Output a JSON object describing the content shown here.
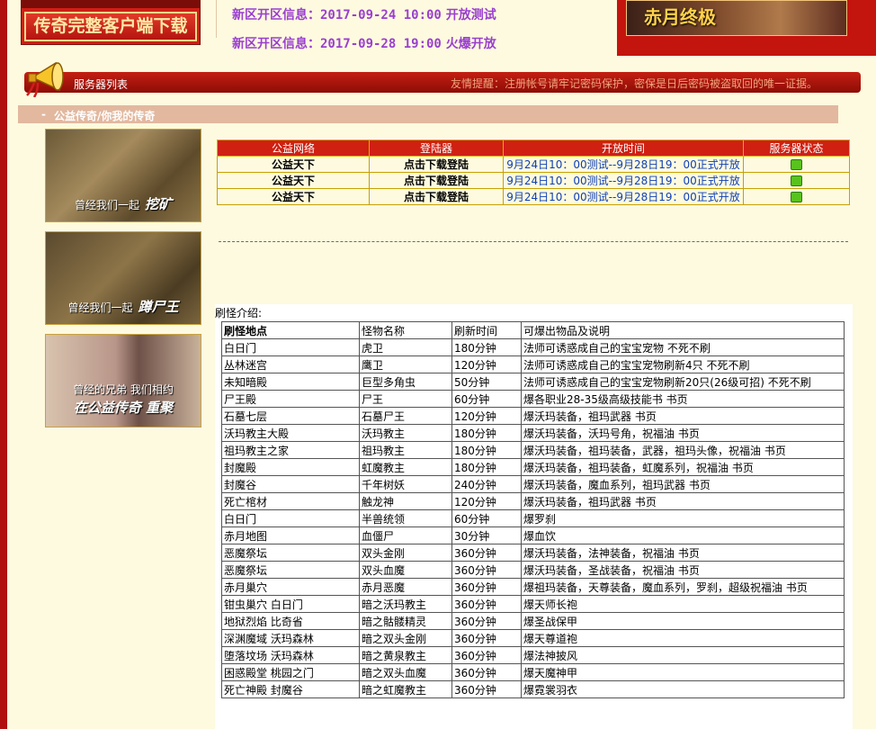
{
  "header": {
    "download_label": "传奇完整客户端下载",
    "news": [
      {
        "prefix": "新区开区信息：",
        "date": "2017-09-24 10:00",
        "status": "开放测试"
      },
      {
        "prefix": "新区开区信息：",
        "date": "2017-09-28 19:00",
        "status": "火爆开放"
      }
    ],
    "banner_right": "赤月终极"
  },
  "server_bar": {
    "title": "服务器列表",
    "tip": "友情提醒：注册帐号请牢记密码保护，密保是日后密码被盗取回的唯一证据。"
  },
  "section": {
    "dash": "-",
    "title": "公益传奇/你我的传奇"
  },
  "thumbs": [
    {
      "caption": "曾经我们一起",
      "emph": "挖矿"
    },
    {
      "caption": "曾经我们一起",
      "emph": "蹲尸王"
    },
    {
      "caption": "曾经的兄弟  我们相约",
      "emph": "在公益传奇  重聚"
    }
  ],
  "server_table": {
    "headers": [
      "公益网络",
      "登陆器",
      "开放时间",
      "服务器状态"
    ],
    "rows": [
      {
        "name": "公益天下",
        "login": "点击下载登陆",
        "time": "9月24日10：00测试--9月28日19：00正式开放"
      },
      {
        "name": "公益天下",
        "login": "点击下载登陆",
        "time": "9月24日10：00测试--9月28日19：00正式开放"
      },
      {
        "name": "公益天下",
        "login": "点击下载登陆",
        "time": "9月24日10：00测试--9月28日19：00正式开放"
      }
    ]
  },
  "monster": {
    "label": "刷怪介绍:",
    "headers": [
      "刷怪地点",
      "怪物名称",
      "刷新时间",
      "可爆出物品及说明"
    ],
    "rows": [
      [
        "白日门",
        "虎卫",
        "180分钟",
        "法师可诱惑成自己的宝宝宠物 不死不刷"
      ],
      [
        "丛林迷宫",
        "鹰卫",
        "120分钟",
        "法师可诱惑成自己的宝宝宠物刷新4只 不死不刷"
      ],
      [
        "未知暗殿",
        "巨型多角虫",
        "50分钟",
        "法师可诱惑成自己的宝宝宠物刷新20只(26级可招) 不死不刷"
      ],
      [
        "尸王殿",
        "尸王",
        "60分钟",
        "爆各职业28-35级高级技能书 书页"
      ],
      [
        "石墓七层",
        "石墓尸王",
        "120分钟",
        "爆沃玛装备，祖玛武器 书页"
      ],
      [
        "沃玛教主大殿",
        "沃玛教主",
        "180分钟",
        "爆沃玛装备，沃玛号角，祝福油 书页"
      ],
      [
        "祖玛教主之家",
        "祖玛教主",
        "180分钟",
        "爆沃玛装备，祖玛装备，武器，祖玛头像，祝福油 书页"
      ],
      [
        "封魔殿",
        "虹魔教主",
        "180分钟",
        "爆沃玛装备，祖玛装备，虹魔系列，祝福油 书页"
      ],
      [
        "封魔谷",
        "千年树妖",
        "240分钟",
        "爆沃玛装备，魔血系列，祖玛武器 书页"
      ],
      [
        "死亡棺材",
        "触龙神",
        "120分钟",
        "爆沃玛装备，祖玛武器 书页"
      ],
      [
        "白日门",
        "半兽统领",
        "60分钟",
        "爆罗刹"
      ],
      [
        "赤月地图",
        "血僵尸",
        "30分钟",
        "爆血饮"
      ],
      [
        "恶魔祭坛",
        "双头金刚",
        "360分钟",
        "爆沃玛装备，法神装备，祝福油 书页"
      ],
      [
        "恶魔祭坛",
        "双头血魔",
        "360分钟",
        "爆沃玛装备，圣战装备，祝福油 书页"
      ],
      [
        "赤月巢穴",
        "赤月恶魔",
        "360分钟",
        "爆祖玛装备，天尊装备，魔血系列，罗刹，超级祝福油 书页"
      ],
      [
        "钳虫巢穴 白日门",
        "暗之沃玛教主",
        "360分钟",
        "爆天师长袍"
      ],
      [
        "地狱烈焰 比奇省",
        "暗之骷髅精灵",
        "360分钟",
        "爆圣战保甲"
      ],
      [
        "深渊魔域 沃玛森林",
        "暗之双头金刚",
        "360分钟",
        "爆天尊道袍"
      ],
      [
        "堕落坟场 沃玛森林",
        "暗之黄泉教主",
        "360分钟",
        "爆法神披风"
      ],
      [
        "困惑殿堂 桃园之门",
        "暗之双头血魔",
        "360分钟",
        "爆天魔神甲"
      ],
      [
        "死亡神殿 封魔谷",
        "暗之虹魔教主",
        "360分钟",
        "爆霓裳羽衣"
      ]
    ]
  }
}
